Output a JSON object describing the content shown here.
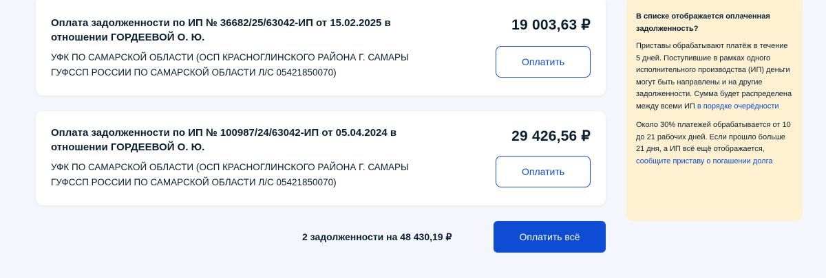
{
  "debts": [
    {
      "title": "Оплата задолженности по ИП № 36682/25/63042-ИП от 15.02.2025 в отношении ГОРДЕЕВОЙ О. Ю.",
      "organization": "УФК ПО САМАРСКОЙ ОБЛАСТИ (ОСП КРАСНОГЛИНСКОГО РАЙОНА Г. САМАРЫ ГУФССП РОССИИ ПО САМАРСКОЙ ОБЛАСТИ Л/С 05421850070)",
      "amount": "19 003,63 ₽",
      "pay_label": "Оплатить"
    },
    {
      "title": "Оплата задолженности по ИП № 100987/24/63042-ИП от 05.04.2024 в отношении ГОРДЕЕВОЙ О. Ю.",
      "organization": "УФК ПО САМАРСКОЙ ОБЛАСТИ (ОСП КРАСНОГЛИНСКОГО РАЙОНА Г. САМАРЫ ГУФССП РОССИИ ПО САМАРСКОЙ ОБЛАСТИ Л/С 05421850070)",
      "amount": "29 426,56 ₽",
      "pay_label": "Оплатить"
    }
  ],
  "summary": {
    "total_text": "2 задолженности на 48 430,19 ₽",
    "pay_all_label": "Оплатить всё"
  },
  "info": {
    "title": "В списке отображается оплаченная задолженность?",
    "para1_text": "Приставы обрабатывают платёж в течение 5 дней. Поступившие в рамках одного исполнительного производства (ИП) деньги могут быть направлены и на другие задолженности. Сумма будет распределена между всеми ИП",
    "para1_link": "в порядке очерёдности",
    "para2_text": "Около 30% платежей обрабатывается от 10 до 21 рабочих дней. Если прошло больше 21 дня, а ИП всё ещё отображается,",
    "para2_link": "сообщите приставу о погашении долга"
  },
  "colors": {
    "accent": "#0d4cd3",
    "info_background": "#fdf1d2",
    "page_background": "#f4f6fb",
    "text": "#0b1f33"
  }
}
